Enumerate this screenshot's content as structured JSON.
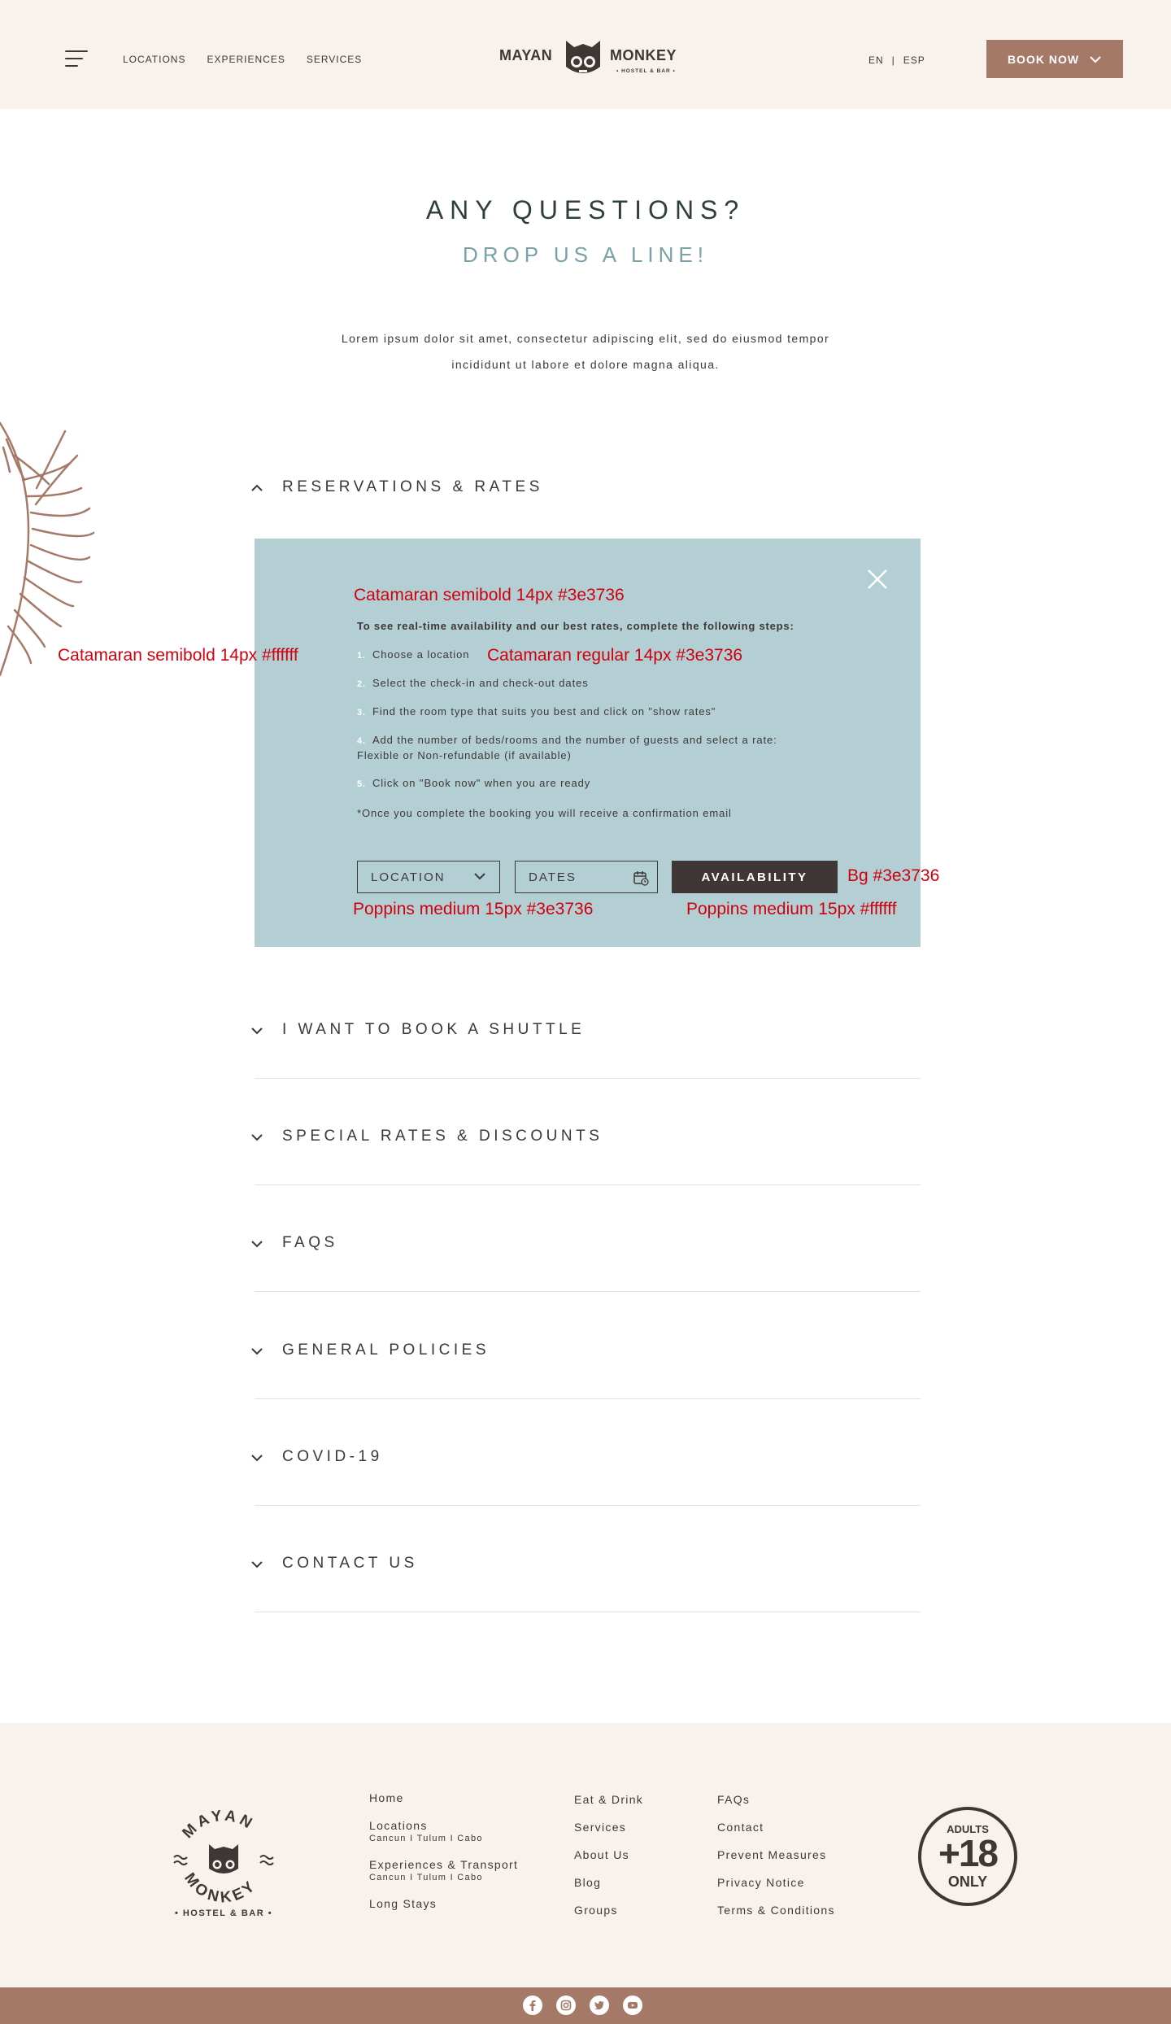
{
  "header": {
    "nav": [
      "LOCATIONS",
      "EXPERIENCES",
      "SERVICES"
    ],
    "logo_left": "MAYAN",
    "logo_right": "MONKEY",
    "logo_sub": "• HOSTEL & BAR •",
    "lang_en": "EN",
    "lang_sep": "|",
    "lang_esp": "ESP",
    "book_now": "BOOK NOW"
  },
  "hero": {
    "title": "ANY QUESTIONS?",
    "subtitle": "DROP US A LINE!",
    "intro_line1": "Lorem ipsum dolor sit amet, consectetur adipiscing elit, sed do eiusmod tempor",
    "intro_line2": "incididunt ut labore et dolore magna aliqua."
  },
  "accordion": {
    "open_section": "RESERVATIONS & RATES",
    "panel": {
      "intro": "To see real-time availability and our best rates, complete the following steps:",
      "steps": [
        {
          "num": "1.",
          "text": "Choose a location"
        },
        {
          "num": "2.",
          "text": "Select the check-in and check-out dates"
        },
        {
          "num": "3.",
          "text": "Find the room type that suits you best and click on \"show rates\""
        },
        {
          "num": "4.",
          "text": "Add the number of beds/rooms and the number of guests and select a rate:",
          "text2": "Flexible or Non-refundable (if available)"
        },
        {
          "num": "5.",
          "text": "Click on \"Book now\" when you are ready"
        }
      ],
      "note": "*Once you complete the booking you will receive a confirmation email",
      "location_label": "LOCATION",
      "dates_label": "DATES",
      "availability_label": "AVAILABILITY"
    },
    "sections": [
      "I WANT TO BOOK A SHUTTLE",
      "SPECIAL RATES & DISCOUNTS",
      "FAQS",
      "GENERAL POLICIES",
      "COVID-19",
      "CONTACT US"
    ]
  },
  "annotations": {
    "intro_font": "Catamaran semibold 14px #3e3736",
    "num_font": "Catamaran semibold 14px #ffffff",
    "step_font": "Catamaran regular 14px #3e3736",
    "field_font": "Poppins medium 15px #3e3736",
    "btn_bg": "Bg #3e3736",
    "btn_font": "Poppins medium 15px #ffffff"
  },
  "footer": {
    "logo_top": "MAYAN",
    "logo_bottom": "MONKEY",
    "logo_sub": "• HOSTEL & BAR •",
    "col1": [
      {
        "label": "Home"
      },
      {
        "label": "Locations",
        "sub": "Cancun I Tulum I Cabo"
      },
      {
        "label": "Experiences & Transport",
        "sub": "Cancun I Tulum I Cabo"
      },
      {
        "label": "Long Stays"
      }
    ],
    "col2": [
      "Eat & Drink",
      "Services",
      "About Us",
      "Blog",
      "Groups"
    ],
    "col3": [
      "FAQs",
      "Contact",
      "Prevent Measures",
      "Privacy Notice",
      "Terms & Conditions"
    ],
    "badge_top": "ADULTS",
    "badge_mid": "+18",
    "badge_bottom": "ONLY"
  },
  "colors": {
    "brand_brown": "#a57967",
    "dark": "#3e3736",
    "panel_bg": "#b3cfd4",
    "subtitle_teal": "#7aa1a7",
    "cream": "#f8f2ec",
    "annotation_red": "#d0000d"
  },
  "icons": [
    "menu-icon",
    "chevron-down-icon",
    "chevron-up-icon",
    "close-icon",
    "calendar-icon",
    "facebook-icon",
    "instagram-icon",
    "twitter-icon",
    "youtube-icon"
  ]
}
